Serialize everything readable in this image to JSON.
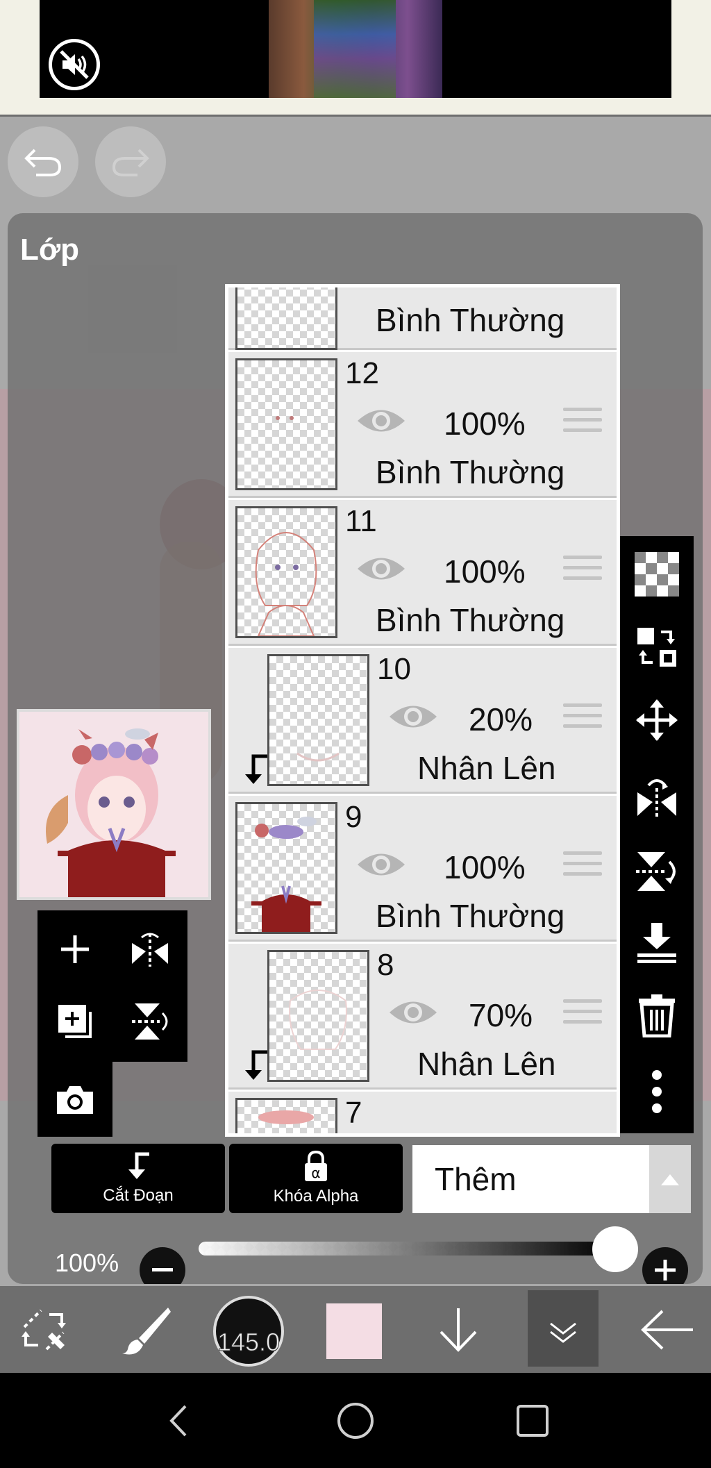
{
  "panel": {
    "title": "Lớp"
  },
  "layers": [
    {
      "name": "",
      "opacity": "",
      "blend": "Bình Thường",
      "clipped": false
    },
    {
      "name": "12",
      "opacity": "100%",
      "blend": "Bình Thường",
      "clipped": false
    },
    {
      "name": "11",
      "opacity": "100%",
      "blend": "Bình Thường",
      "clipped": false
    },
    {
      "name": "10",
      "opacity": "20%",
      "blend": "Nhân Lên",
      "clipped": true
    },
    {
      "name": "9",
      "opacity": "100%",
      "blend": "Bình Thường",
      "clipped": false
    },
    {
      "name": "8",
      "opacity": "70%",
      "blend": "Nhân Lên",
      "clipped": true
    },
    {
      "name": "7",
      "opacity": "",
      "blend": "",
      "clipped": false
    }
  ],
  "controls": {
    "clip_label": "Cắt Đoạn",
    "alpha_lock_label": "Khóa Alpha",
    "blend_mode_value": "Thêm",
    "opacity_value": "100%",
    "opacity_level": 1.0
  },
  "bottom_toolbar": {
    "brush_size": "145.0",
    "color": "#f4dde4"
  },
  "colors": {
    "panel_bg": "#707070",
    "layer_row_bg": "#e8e8e8",
    "toolbar_bg": "#000000"
  },
  "icons": [
    "mute-icon",
    "undo-icon",
    "redo-icon",
    "add-layer-icon",
    "flip-horizontal-icon",
    "add-folder-icon",
    "flip-vertical-icon",
    "camera-icon",
    "transparency-icon",
    "replace-icon",
    "move-icon",
    "rotate-flip-h-icon",
    "rotate-flip-v-icon",
    "merge-down-icon",
    "trash-icon",
    "more-icon",
    "transform-icon",
    "brush-icon",
    "down-arrow-icon",
    "collapse-icon",
    "back-arrow-icon",
    "nav-back-icon",
    "nav-home-icon",
    "nav-recents-icon"
  ]
}
